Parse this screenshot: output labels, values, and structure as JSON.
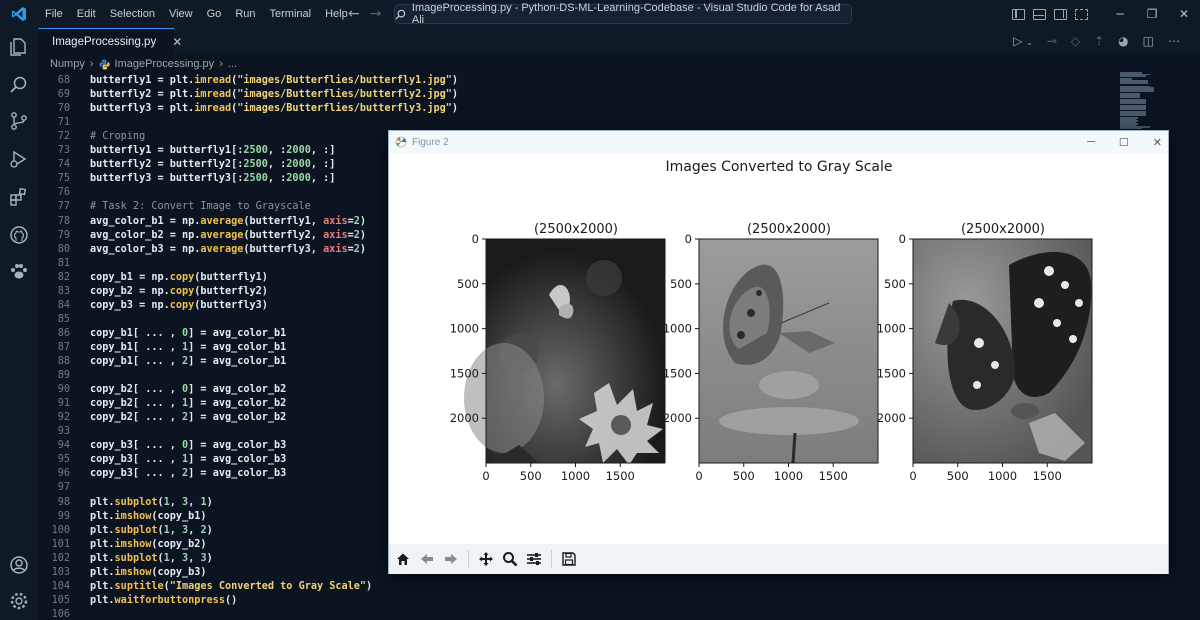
{
  "titlebar": {
    "menu": [
      "File",
      "Edit",
      "Selection",
      "View",
      "Go",
      "Run",
      "Terminal",
      "Help"
    ],
    "command_center": "ImageProcessing.py - Python-DS-ML-Learning-Codebase - Visual Studio Code for Asad Ali"
  },
  "tab": {
    "label": "ImageProcessing.py"
  },
  "breadcrumb": {
    "folder": "Numpy",
    "file": "ImageProcessing.py",
    "more": "..."
  },
  "code_lines": [
    {
      "n": "68",
      "t": [
        [
          "butterfly1 = ",
          ""
        ],
        [
          "plt",
          ""
        ],
        [
          ".",
          ""
        ],
        [
          "imread",
          "fn"
        ],
        [
          "(",
          ""
        ],
        [
          "\"images/Butterflies/butterfly1.jpg\"",
          "str"
        ],
        [
          ")",
          ""
        ]
      ]
    },
    {
      "n": "69",
      "t": [
        [
          "butterfly2 = ",
          ""
        ],
        [
          "plt",
          ""
        ],
        [
          ".",
          ""
        ],
        [
          "imread",
          "fn"
        ],
        [
          "(",
          ""
        ],
        [
          "\"images/Butterflies/butterfly2.jpg\"",
          "str"
        ],
        [
          ")",
          ""
        ]
      ]
    },
    {
      "n": "70",
      "t": [
        [
          "butterfly3 = ",
          ""
        ],
        [
          "plt",
          ""
        ],
        [
          ".",
          ""
        ],
        [
          "imread",
          "fn"
        ],
        [
          "(",
          ""
        ],
        [
          "\"images/Butterflies/butterfly3.jpg\"",
          "str"
        ],
        [
          ")",
          ""
        ]
      ]
    },
    {
      "n": "71",
      "t": []
    },
    {
      "n": "72",
      "t": [
        [
          "# Croping",
          "cm"
        ]
      ]
    },
    {
      "n": "73",
      "t": [
        [
          "butterfly1 = butterfly1[:",
          ""
        ],
        [
          "2500",
          "num"
        ],
        [
          ", :",
          ""
        ],
        [
          "2000",
          "num"
        ],
        [
          ", :]",
          ""
        ]
      ]
    },
    {
      "n": "74",
      "t": [
        [
          "butterfly2 = butterfly2[:",
          ""
        ],
        [
          "2500",
          "num"
        ],
        [
          ", :",
          ""
        ],
        [
          "2000",
          "num"
        ],
        [
          ", :]",
          ""
        ]
      ]
    },
    {
      "n": "75",
      "t": [
        [
          "butterfly3 = butterfly3[:",
          ""
        ],
        [
          "2500",
          "num"
        ],
        [
          ", :",
          ""
        ],
        [
          "2000",
          "num"
        ],
        [
          ", :]",
          ""
        ]
      ]
    },
    {
      "n": "76",
      "t": []
    },
    {
      "n": "77",
      "t": [
        [
          "# Task 2: Convert Image to Grayscale",
          "cm"
        ]
      ]
    },
    {
      "n": "78",
      "t": [
        [
          "avg_color_b1 = np.",
          ""
        ],
        [
          "average",
          "fn"
        ],
        [
          "(butterfly1, ",
          ""
        ],
        [
          "axis",
          "kw"
        ],
        [
          "=",
          ""
        ],
        [
          "2",
          "num"
        ],
        [
          ")",
          ""
        ]
      ]
    },
    {
      "n": "79",
      "t": [
        [
          "avg_color_b2 = np.",
          ""
        ],
        [
          "average",
          "fn"
        ],
        [
          "(butterfly2, ",
          ""
        ],
        [
          "axis",
          "kw"
        ],
        [
          "=",
          ""
        ],
        [
          "2",
          "num"
        ],
        [
          ")",
          ""
        ]
      ]
    },
    {
      "n": "80",
      "t": [
        [
          "avg_color_b3 = np.",
          ""
        ],
        [
          "average",
          "fn"
        ],
        [
          "(butterfly3, ",
          ""
        ],
        [
          "axis",
          "kw"
        ],
        [
          "=",
          ""
        ],
        [
          "2",
          "num"
        ],
        [
          ")",
          ""
        ]
      ]
    },
    {
      "n": "81",
      "t": []
    },
    {
      "n": "82",
      "t": [
        [
          "copy_b1 = np.",
          ""
        ],
        [
          "copy",
          "fn"
        ],
        [
          "(butterfly1)",
          ""
        ]
      ]
    },
    {
      "n": "83",
      "t": [
        [
          "copy_b2 = np.",
          ""
        ],
        [
          "copy",
          "fn"
        ],
        [
          "(butterfly2)",
          ""
        ]
      ]
    },
    {
      "n": "84",
      "t": [
        [
          "copy_b3 = np.",
          ""
        ],
        [
          "copy",
          "fn"
        ],
        [
          "(butterfly3)",
          ""
        ]
      ]
    },
    {
      "n": "85",
      "t": []
    },
    {
      "n": "86",
      "t": [
        [
          "copy_b1[ ... , ",
          ""
        ],
        [
          "0",
          "num"
        ],
        [
          "] = avg_color_b1",
          ""
        ]
      ]
    },
    {
      "n": "87",
      "t": [
        [
          "copy_b1[ ... , ",
          ""
        ],
        [
          "1",
          "num"
        ],
        [
          "] = avg_color_b1",
          ""
        ]
      ]
    },
    {
      "n": "88",
      "t": [
        [
          "copy_b1[ ... , ",
          ""
        ],
        [
          "2",
          "num"
        ],
        [
          "] = avg_color_b1",
          ""
        ]
      ]
    },
    {
      "n": "89",
      "t": []
    },
    {
      "n": "90",
      "t": [
        [
          "copy_b2[ ... , ",
          ""
        ],
        [
          "0",
          "num"
        ],
        [
          "] = avg_color_b2",
          ""
        ]
      ]
    },
    {
      "n": "91",
      "t": [
        [
          "copy_b2[ ... , ",
          ""
        ],
        [
          "1",
          "num"
        ],
        [
          "] = avg_color_b2",
          ""
        ]
      ]
    },
    {
      "n": "92",
      "t": [
        [
          "copy_b2[ ... , ",
          ""
        ],
        [
          "2",
          "num"
        ],
        [
          "] = avg_color_b2",
          ""
        ]
      ]
    },
    {
      "n": "93",
      "t": []
    },
    {
      "n": "94",
      "t": [
        [
          "copy_b3[ ... , ",
          ""
        ],
        [
          "0",
          "num"
        ],
        [
          "] = avg_color_b3",
          ""
        ]
      ]
    },
    {
      "n": "95",
      "t": [
        [
          "copy_b3[ ... , ",
          ""
        ],
        [
          "1",
          "num"
        ],
        [
          "] = avg_color_b3",
          ""
        ]
      ]
    },
    {
      "n": "96",
      "t": [
        [
          "copy_b3[ ... , ",
          ""
        ],
        [
          "2",
          "num"
        ],
        [
          "] = avg_color_b3",
          ""
        ]
      ]
    },
    {
      "n": "97",
      "t": []
    },
    {
      "n": "98",
      "t": [
        [
          "plt.",
          ""
        ],
        [
          "subplot",
          "fn"
        ],
        [
          "(",
          ""
        ],
        [
          "1",
          "num"
        ],
        [
          ", ",
          ""
        ],
        [
          "3",
          "num"
        ],
        [
          ", ",
          ""
        ],
        [
          "1",
          "num"
        ],
        [
          ")",
          ""
        ]
      ]
    },
    {
      "n": "99",
      "t": [
        [
          "plt.",
          ""
        ],
        [
          "imshow",
          "fn"
        ],
        [
          "(copy_b1)",
          ""
        ]
      ]
    },
    {
      "n": "100",
      "t": [
        [
          "plt.",
          ""
        ],
        [
          "subplot",
          "fn"
        ],
        [
          "(",
          ""
        ],
        [
          "1",
          "num"
        ],
        [
          ", ",
          ""
        ],
        [
          "3",
          "num"
        ],
        [
          ", ",
          ""
        ],
        [
          "2",
          "num"
        ],
        [
          ")",
          ""
        ]
      ]
    },
    {
      "n": "101",
      "t": [
        [
          "plt.",
          ""
        ],
        [
          "imshow",
          "fn"
        ],
        [
          "(copy_b2)",
          ""
        ]
      ]
    },
    {
      "n": "102",
      "t": [
        [
          "plt.",
          ""
        ],
        [
          "subplot",
          "fn"
        ],
        [
          "(",
          ""
        ],
        [
          "1",
          "num"
        ],
        [
          ", ",
          ""
        ],
        [
          "3",
          "num"
        ],
        [
          ", ",
          ""
        ],
        [
          "3",
          "num"
        ],
        [
          ")",
          ""
        ]
      ]
    },
    {
      "n": "103",
      "t": [
        [
          "plt.",
          ""
        ],
        [
          "imshow",
          "fn"
        ],
        [
          "(copy_b3)",
          ""
        ]
      ]
    },
    {
      "n": "104",
      "t": [
        [
          "plt.",
          ""
        ],
        [
          "suptitle",
          "fn"
        ],
        [
          "(",
          ""
        ],
        [
          "\"Images Converted to Gray Scale\"",
          "str"
        ],
        [
          ")",
          ""
        ]
      ]
    },
    {
      "n": "105",
      "t": [
        [
          "plt.",
          ""
        ],
        [
          "waitforbuttonpress",
          "fn"
        ],
        [
          "()",
          ""
        ]
      ]
    },
    {
      "n": "106",
      "t": []
    }
  ],
  "figure": {
    "window_title": "Figure 2",
    "suptitle": "Images Converted to Gray Scale",
    "subplots": [
      {
        "title": "(2500x2000)"
      },
      {
        "title": "(2500x2000)"
      },
      {
        "title": "(2500x2000)"
      }
    ],
    "y_ticks": [
      "0",
      "500",
      "1000",
      "1500",
      "2000"
    ],
    "x_ticks": [
      "0",
      "500",
      "1000",
      "1500"
    ]
  },
  "colors": {
    "accent": "#3794ff",
    "editor_bg": "#0b1420",
    "chrome_bg": "#0e1a26"
  }
}
